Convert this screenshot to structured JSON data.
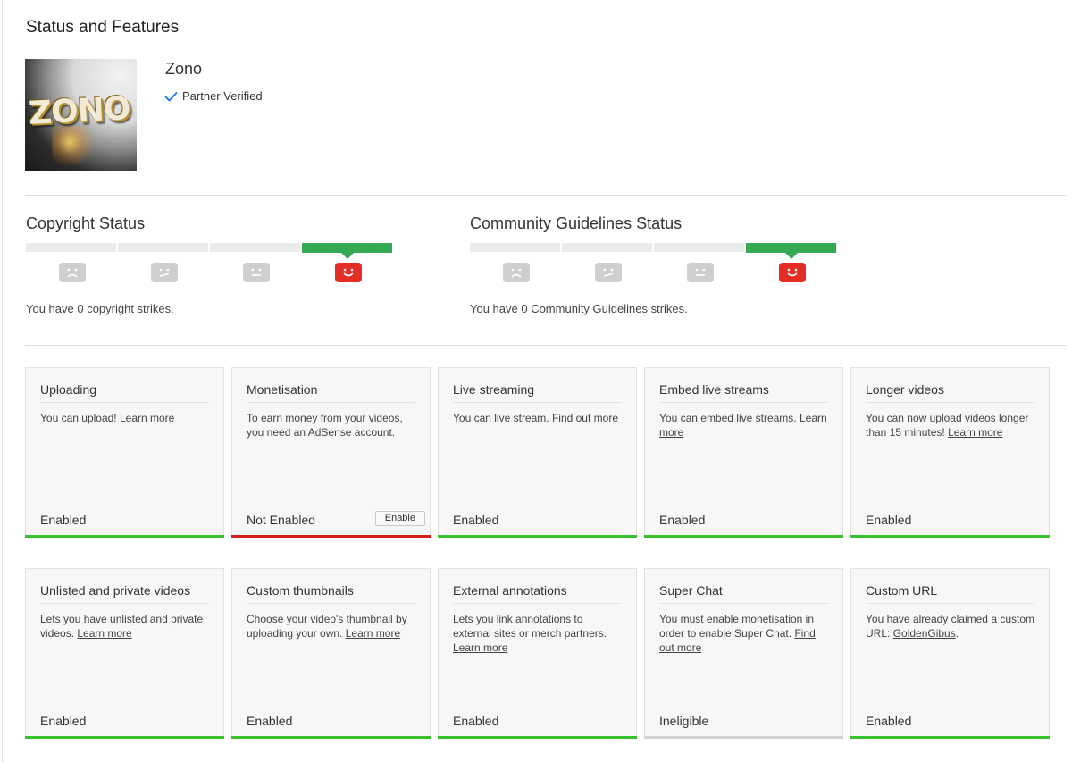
{
  "page_title": "Status and Features",
  "channel": {
    "name": "Zono",
    "badge": "Partner Verified",
    "logo_text": "ZONO"
  },
  "copyright": {
    "title": "Copyright Status",
    "strikes_text": "You have 0 copyright strikes."
  },
  "community": {
    "title": "Community Guidelines Status",
    "strikes_text": "You have 0 Community Guidelines strikes."
  },
  "cards": [
    {
      "title": "Uploading",
      "desc": "You can upload! ",
      "link": "Learn more",
      "state": "Enabled"
    },
    {
      "title": "Monetisation",
      "desc": "To earn money from your videos, you need an AdSense account.",
      "state": "Not Enabled",
      "button": "Enable"
    },
    {
      "title": "Live streaming",
      "desc": "You can live stream. ",
      "link": "Find out more",
      "state": "Enabled"
    },
    {
      "title": "Embed live streams",
      "desc": "You can embed live streams. ",
      "link": "Learn more",
      "state": "Enabled"
    },
    {
      "title": "Longer videos",
      "desc": "You can now upload videos longer than 15 minutes! ",
      "link": "Learn more",
      "state": "Enabled"
    },
    {
      "title": "Unlisted and private videos",
      "desc": "Lets you have unlisted and private videos. ",
      "link": "Learn more",
      "state": "Enabled"
    },
    {
      "title": "Custom thumbnails",
      "desc": "Choose your video's thumbnail by uploading your own. ",
      "link": "Learn more",
      "state": "Enabled"
    },
    {
      "title": "External annotations",
      "desc": "Lets you link annotations to external sites or merch partners. ",
      "link": "Learn more",
      "state": "Enabled"
    },
    {
      "title": "Super Chat",
      "desc_pre": "You must ",
      "link1": "enable monetisation",
      "desc_mid": " in order to enable Super Chat. ",
      "link2": "Find out more",
      "state": "Ineligible"
    },
    {
      "title": "Custom URL",
      "desc_pre": "You have already claimed a custom URL: ",
      "link": "GoldenGibus",
      "desc_post": ".",
      "state": "Enabled"
    }
  ],
  "colors": {
    "enabled": "#39c12d",
    "not_enabled": "#d6201b",
    "ineligible": "#d3d3d3",
    "active_strike": "#34a853",
    "active_face": "#e52d27",
    "check": "#1a73e8"
  },
  "icons": {
    "partner": "check-icon",
    "strike_faces": [
      "sad-face-icon",
      "meh-face-icon",
      "neutral-face-icon",
      "happy-face-icon"
    ]
  }
}
